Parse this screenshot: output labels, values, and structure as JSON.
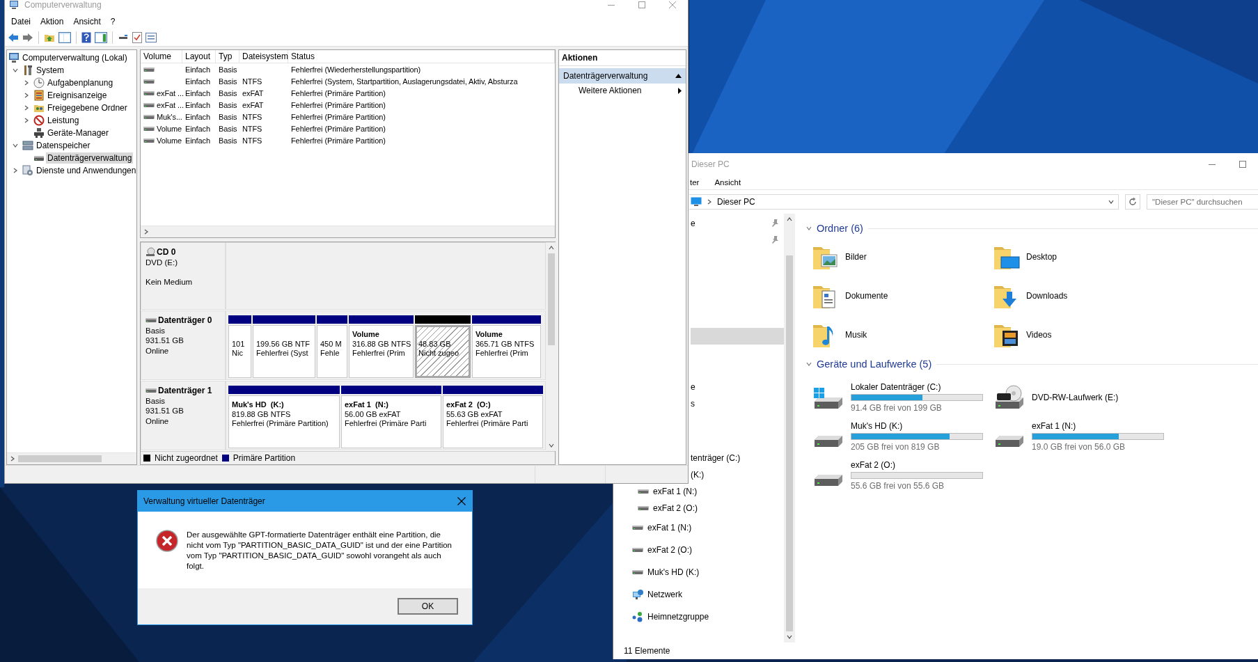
{
  "computer_management": {
    "title": "Computerverwaltung",
    "menu": [
      "Datei",
      "Aktion",
      "Ansicht",
      "?"
    ],
    "tree": [
      {
        "label": "Computerverwaltung (Lokal)",
        "kind": "computer",
        "selected": false,
        "children": [
          {
            "label": "System",
            "kind": "tools",
            "expanded": true,
            "selected": false,
            "children": [
              {
                "label": "Aufgabenplanung",
                "kind": "clock",
                "expanded": false,
                "selected": false
              },
              {
                "label": "Ereignisanzeige",
                "kind": "log",
                "expanded": false,
                "selected": false
              },
              {
                "label": "Freigegebene Ordner",
                "kind": "share",
                "expanded": false,
                "selected": false
              },
              {
                "label": "Leistung",
                "kind": "performance",
                "expanded": false,
                "selected": false
              },
              {
                "label": "Geräte-Manager",
                "kind": "devices",
                "selected": false
              }
            ]
          },
          {
            "label": "Datenspeicher",
            "kind": "storage",
            "expanded": true,
            "selected": false,
            "children": [
              {
                "label": "Datenträgerverwaltung",
                "kind": "disk",
                "selected": true
              }
            ]
          },
          {
            "label": "Dienste und Anwendungen",
            "kind": "services",
            "expanded": false,
            "selected": false
          }
        ]
      }
    ],
    "volumes": {
      "columns": [
        "Volume",
        "Layout",
        "Typ",
        "Dateisystem",
        "Status"
      ],
      "rows": [
        {
          "layout": "Einfach",
          "type": "Basis",
          "status": "Fehlerfrei (Wiederherstellungspartition)"
        },
        {
          "layout": "Einfach",
          "type": "Basis",
          "file_system": "NTFS",
          "status": "Fehlerfrei (System, Startpartition, Auslagerungsdatei, Aktiv, Absturza"
        },
        {
          "volume": "exFat ...",
          "layout": "Einfach",
          "type": "Basis",
          "file_system": "exFAT",
          "status": "Fehlerfrei (Primäre Partition)"
        },
        {
          "volume": "exFat ...",
          "layout": "Einfach",
          "type": "Basis",
          "file_system": "exFAT",
          "status": "Fehlerfrei (Primäre Partition)"
        },
        {
          "volume": "Muk's...",
          "layout": "Einfach",
          "type": "Basis",
          "file_system": "NTFS",
          "status": "Fehlerfrei (Primäre Partition)"
        },
        {
          "volume": "Volume",
          "layout": "Einfach",
          "type": "Basis",
          "file_system": "NTFS",
          "status": "Fehlerfrei (Primäre Partition)"
        },
        {
          "volume": "Volume",
          "layout": "Einfach",
          "type": "Basis",
          "file_system": "NTFS",
          "status": "Fehlerfrei (Primäre Partition)"
        }
      ]
    },
    "disks": [
      {
        "name": "CD 0",
        "kind": "cd",
        "type": "DVD (E:)",
        "status": "Kein Medium"
      },
      {
        "name": "Datenträger 0",
        "kind": "disk",
        "type": "Basis",
        "size": "931.51 GB",
        "status": "Online",
        "partitions": [
          {
            "allocated": true,
            "selected": false,
            "lines": [
              "101",
              "Nic"
            ]
          },
          {
            "allocated": true,
            "selected": false,
            "lines": [
              "199.56 GB NTF",
              "Fehlerfrei (Syst"
            ]
          },
          {
            "allocated": true,
            "selected": false,
            "lines": [
              "450 M",
              "Fehle"
            ]
          },
          {
            "allocated": true,
            "selected": false,
            "title": "Volume",
            "lines": [
              "316.88 GB NTFS",
              "Fehlerfrei (Prim"
            ]
          },
          {
            "allocated": false,
            "selected": true,
            "lines": [
              "48.83 GB",
              "Nicht zugeo"
            ]
          },
          {
            "allocated": true,
            "selected": false,
            "title": "Volume",
            "lines": [
              "365.71 GB NTFS",
              "Fehlerfrei (Prim"
            ]
          }
        ]
      },
      {
        "name": "Datenträger 1",
        "kind": "disk",
        "type": "Basis",
        "size": "931.51 GB",
        "status": "Online",
        "partitions": [
          {
            "allocated": true,
            "selected": false,
            "title": "Muk's HD  (K:)",
            "lines": [
              "819.88 GB NTFS",
              "Fehlerfrei (Primäre Partition)"
            ]
          },
          {
            "allocated": true,
            "selected": false,
            "title": "exFat 1  (N:)",
            "lines": [
              "56.00 GB exFAT",
              "Fehlerfrei (Primäre Parti"
            ]
          },
          {
            "allocated": true,
            "selected": false,
            "title": "exFat 2  (O:)",
            "lines": [
              "55.63 GB exFAT",
              "Fehlerfrei (Primäre Parti"
            ]
          }
        ]
      }
    ],
    "legend": [
      {
        "label": "Nicht zugeordnet",
        "color": "#000000"
      },
      {
        "label": "Primäre Partition",
        "color": "#000080"
      }
    ],
    "actions": {
      "title": "Aktionen",
      "items": [
        {
          "label": "Datenträgerverwaltung",
          "kind": "section"
        },
        {
          "label": "Weitere Aktionen",
          "kind": "submenu"
        }
      ]
    }
  },
  "explorer": {
    "title": "Dieser PC",
    "ribbon_tabs": [
      "ter",
      "Ansicht"
    ],
    "address": "Dieser PC",
    "search": {
      "placeholder": "\"Dieser PC\" durchsuchen"
    },
    "nav": [
      {
        "items": [
          {
            "label": "e",
            "kind": "cut",
            "pinned": true,
            "selected": false
          },
          {
            "kind": "cut",
            "pinned": true,
            "selected": false
          }
        ]
      },
      {
        "items": [
          {
            "kind": "cut",
            "selected": true
          }
        ]
      },
      {
        "items": [
          {
            "label": "e",
            "kind": "cut",
            "selected": false
          },
          {
            "label": "s",
            "kind": "cut",
            "selected": false
          }
        ]
      },
      {
        "items": [
          {
            "label": "tenträger (C:)",
            "kind": "cut",
            "selected": false
          },
          {
            "label": "(K:)",
            "kind": "cut",
            "selected": false
          },
          {
            "label": "exFat 1 (N:)",
            "kind": "subdrive",
            "selected": false
          },
          {
            "label": "exFat 2 (O:)",
            "kind": "subdrive",
            "selected": false
          }
        ]
      },
      {
        "items": [
          {
            "label": "exFat 1 (N:)",
            "kind": "drive",
            "selected": false
          },
          {
            "label": "exFat 2 (O:)",
            "kind": "drive",
            "selected": false
          },
          {
            "label": "Muk's HD (K:)",
            "kind": "drive",
            "selected": false
          },
          {
            "label": "Netzwerk",
            "kind": "network",
            "selected": false
          },
          {
            "label": "Heimnetzgruppe",
            "kind": "homegroup",
            "selected": false
          }
        ]
      }
    ],
    "groups": [
      {
        "title": "Ordner (6)",
        "expanded": true,
        "items": [
          {
            "label": "Bilder",
            "kind": "pictures"
          },
          {
            "label": "Desktop",
            "kind": "desktop"
          },
          {
            "label": "Dokumente",
            "kind": "documents"
          },
          {
            "label": "Downloads",
            "kind": "downloads"
          },
          {
            "label": "Musik",
            "kind": "music"
          },
          {
            "label": "Videos",
            "kind": "videos"
          }
        ]
      },
      {
        "title": "Geräte und Laufwerke (5)",
        "expanded": true,
        "items": [
          {
            "label": "Lokaler Datenträger (C:)",
            "kind": "system",
            "level": 0.54,
            "free": "91.4 GB frei von 199 GB"
          },
          {
            "label": "DVD-RW-Laufwerk (E:)",
            "kind": "dvd"
          },
          {
            "label": "Muk's HD (K:)",
            "kind": "drive",
            "level": 0.75,
            "free": "205 GB frei von 819 GB"
          },
          {
            "label": "exFat 1 (N:)",
            "kind": "drive",
            "level": 0.66,
            "free": "19.0 GB frei von 56.0 GB"
          },
          {
            "label": "exFat 2 (O:)",
            "kind": "drive",
            "level": 0,
            "free": "55.6 GB frei von 55.6 GB"
          }
        ]
      }
    ],
    "status": "11 Elemente"
  },
  "dialog": {
    "title": "Verwaltung virtueller Datenträger",
    "message": "Der ausgewählte GPT-formatierte Datenträger enthält eine Partition, die nicht vom Typ \"PARTITION_BASIC_DATA_GUID\" ist und der eine Partition vom Typ \"PARTITION_BASIC_DATA_GUID\" sowohl vorangeht als auch folgt.",
    "buttons": [
      "OK"
    ]
  }
}
